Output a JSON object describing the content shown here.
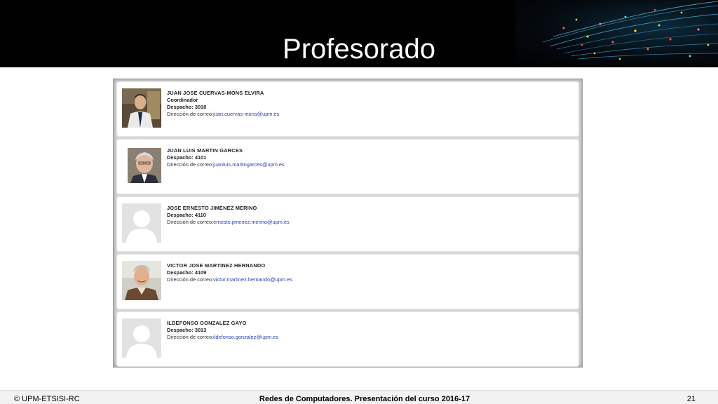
{
  "slide": {
    "title": "Profesorado"
  },
  "faculty": [
    {
      "name": "JUAN JOSE CUERVAS-MONS ELVIRA",
      "role": "Coordinador",
      "office": "Despacho: 3018",
      "email_label": "Dirección de correo:",
      "email": "juan.cuervas-mons@upm.es",
      "photo": "man-in-suit-photo"
    },
    {
      "name": "JUAN LUIS MARTIN GARCES",
      "role": "",
      "office": "Despacho: 4101",
      "email_label": "Dirección de correo:",
      "email": "juanluis.martingarces@upm.es",
      "photo": "gray-haired-man-photo"
    },
    {
      "name": "JOSE ERNESTO JIMENEZ MERINO",
      "role": "",
      "office": "Despacho: 4110",
      "email_label": "Dirección de correo:",
      "email": "ernesto.jimenez.merino@upm.es",
      "photo": "default-avatar"
    },
    {
      "name": "VICTOR JOSE MARTINEZ HERNANDO",
      "role": "",
      "office": "Despacho: 4109",
      "email_label": "Dirección de correo:",
      "email": "victor.martinez.hernando@upm.es",
      "photo": "smiling-man-photo"
    },
    {
      "name": "ILDEFONSO GONZALEZ GAYO",
      "role": "",
      "office": "Despacho: 3013",
      "email_label": "Dirección de correo:",
      "email": "ildefonso.gonzalez@upm.es",
      "photo": "default-avatar"
    }
  ],
  "footer": {
    "left": "© UPM-ETSISI-RC",
    "center": "Redes de Computadores. Presentación del curso 2016-17",
    "page_number": "21"
  },
  "colors": {
    "header_bg": "#000000",
    "link": "#2a3fb0",
    "footer_bg": "#f2f2f2"
  }
}
